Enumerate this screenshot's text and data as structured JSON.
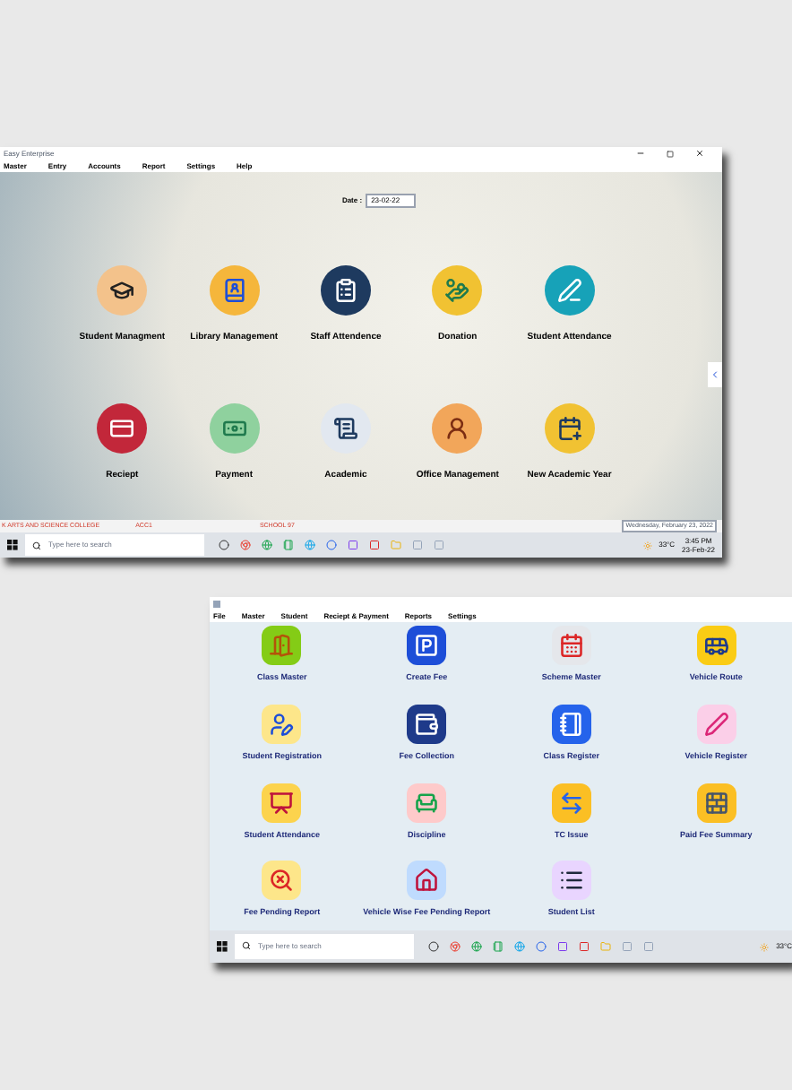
{
  "main_window": {
    "title": "Easy Enterprise",
    "menu": [
      "Master",
      "Entry",
      "Accounts",
      "Report",
      "Settings",
      "Help"
    ],
    "date": {
      "label": "Date :",
      "value": "23-02-22"
    },
    "tiles": [
      {
        "label": "Student Managment"
      },
      {
        "label": "Library Management"
      },
      {
        "label": "Staff Attendence"
      },
      {
        "label": "Donation"
      },
      {
        "label": "Student Attendance"
      },
      {
        "label": "Reciept"
      },
      {
        "label": "Payment"
      },
      {
        "label": "Academic"
      },
      {
        "label": "Office Management"
      },
      {
        "label": "New Academic Year"
      }
    ],
    "status_bar": [
      "K ARTS AND SCIENCE COLLEGE",
      "ACC1",
      "SCHOOL 97"
    ],
    "status_date": "Wednesday, February 23, 2022",
    "taskbar": {
      "search_placeholder": "Type here to search",
      "temperature": "33°C",
      "time": "3:45 PM",
      "date": "23-Feb-22"
    }
  },
  "second_window": {
    "menu": [
      "File",
      "Master",
      "Student",
      "Reciept & Payment",
      "Reports",
      "Settings"
    ],
    "tiles": [
      {
        "label": "Class Master"
      },
      {
        "label": "Create Fee"
      },
      {
        "label": "Scheme Master"
      },
      {
        "label": "Vehicle Route"
      },
      {
        "label": "Student Registration"
      },
      {
        "label": "Fee Collection"
      },
      {
        "label": "Class Register"
      },
      {
        "label": "Vehicle Register"
      },
      {
        "label": "Student Attendance"
      },
      {
        "label": "Discipline"
      },
      {
        "label": "TC Issue"
      },
      {
        "label": "Paid Fee Summary"
      },
      {
        "label": "Fee Pending Report"
      },
      {
        "label": "Vehicle Wise Fee Pending Report"
      },
      {
        "label": "Student List"
      }
    ],
    "taskbar": {
      "search_placeholder": "Type here to search",
      "temperature": "33°C"
    }
  }
}
